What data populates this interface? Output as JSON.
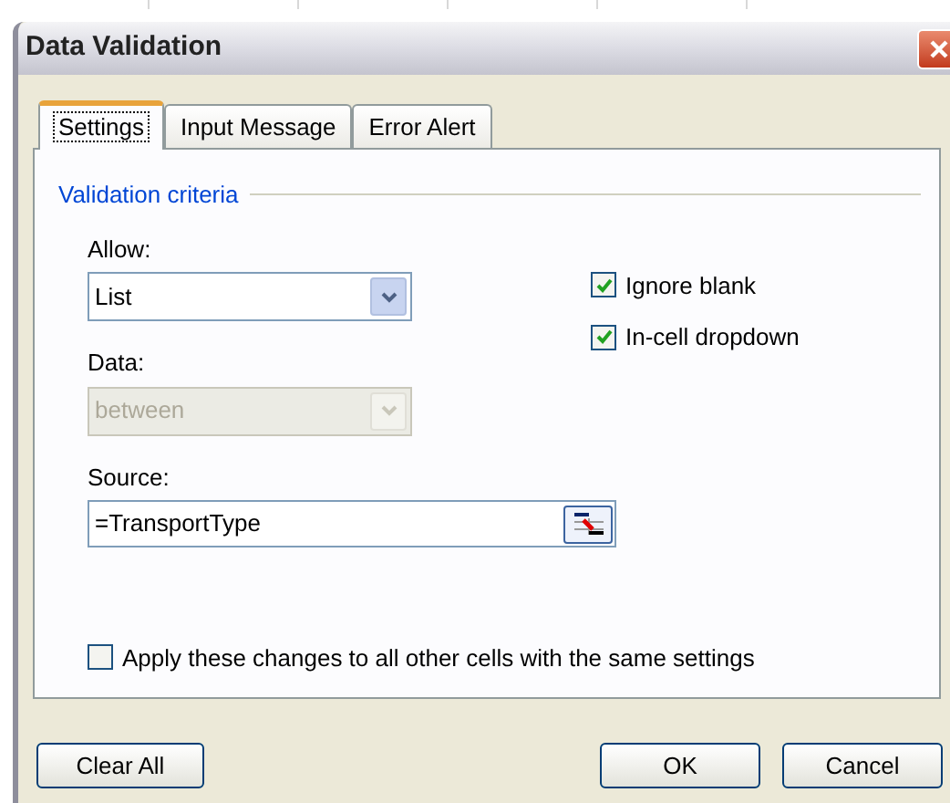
{
  "window": {
    "title": "Data Validation"
  },
  "tabs": [
    {
      "label": "Settings",
      "selected": true
    },
    {
      "label": "Input Message",
      "selected": false
    },
    {
      "label": "Error Alert",
      "selected": false
    }
  ],
  "group": {
    "title": "Validation criteria"
  },
  "allow": {
    "label": "Allow:",
    "value": "List",
    "disabled": false
  },
  "data": {
    "label": "Data:",
    "value": "between",
    "disabled": true
  },
  "source": {
    "label": "Source:",
    "value": "=TransportType"
  },
  "options": [
    {
      "label": "Ignore blank",
      "checked": true
    },
    {
      "label": "In-cell dropdown",
      "checked": true
    }
  ],
  "apply_all": {
    "label": "Apply these changes to all other cells with the same settings",
    "checked": false
  },
  "buttons": [
    {
      "label": "Clear All",
      "kind": "left"
    },
    {
      "label": "OK",
      "kind": "right"
    },
    {
      "label": "Cancel",
      "kind": "right"
    }
  ]
}
